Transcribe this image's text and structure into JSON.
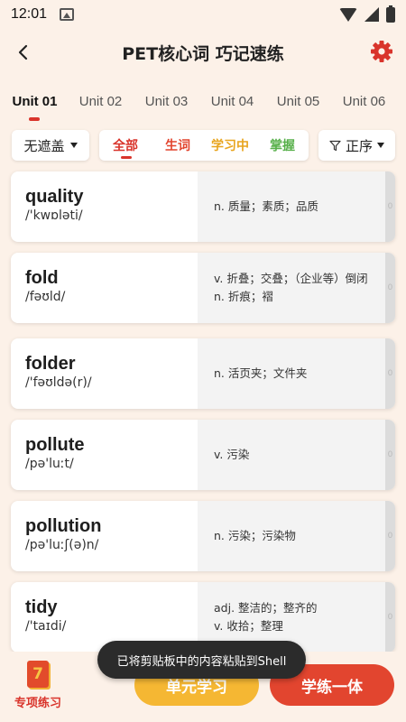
{
  "status_bar": {
    "time": "12:01"
  },
  "header": {
    "title": "PET核心词 巧记速练",
    "back_label": "‹"
  },
  "unit_tabs": [
    {
      "label": "Unit 01",
      "active": true
    },
    {
      "label": "Unit 02",
      "active": false
    },
    {
      "label": "Unit 03",
      "active": false
    },
    {
      "label": "Unit 04",
      "active": false
    },
    {
      "label": "Unit 05",
      "active": false
    },
    {
      "label": "Unit 06",
      "active": false
    }
  ],
  "filters": {
    "cover": "无遮盖",
    "status_items": [
      {
        "label": "全部",
        "color": "#d9342b",
        "active": true
      },
      {
        "label": "生词",
        "color": "#e2452f",
        "active": false
      },
      {
        "label": "学习中",
        "color": "#e8a51f",
        "active": false
      },
      {
        "label": "掌握",
        "color": "#57b04a",
        "active": false
      }
    ],
    "sort": "正序"
  },
  "words": [
    {
      "word": "quality",
      "phonetic": "/'kwɒləti/",
      "defs": [
        "n. 质量；素质；品质"
      ],
      "count": "0"
    },
    {
      "word": "fold",
      "phonetic": "/fəʊld/",
      "defs": [
        "v. 折叠；交叠；（企业等）倒闭",
        "n. 折痕；褶"
      ],
      "count": "0"
    },
    {
      "word": "folder",
      "phonetic": "/'fəʊldə(r)/",
      "defs": [
        "n. 活页夹；文件夹"
      ],
      "count": "0"
    },
    {
      "word": "pollute",
      "phonetic": "/pə'luːt/",
      "defs": [
        "v. 污染"
      ],
      "count": "0"
    },
    {
      "word": "pollution",
      "phonetic": "/pə'luːʃ(ə)n/",
      "defs": [
        "n. 污染；污染物"
      ],
      "count": "0"
    },
    {
      "word": "tidy",
      "phonetic": "/'taɪdi/",
      "defs": [
        "adj. 整洁的；整齐的",
        "v. 收拾；整理"
      ],
      "count": "0"
    }
  ],
  "bottom": {
    "special_label": "专项练习",
    "special_icon_text": "7",
    "unit_study": "单元学习",
    "practice": "学练一体"
  },
  "toast": "已将剪贴板中的内容粘贴到Shell",
  "colors": {
    "accent": "#d9342b",
    "background": "#fcf1e8",
    "unit_button": "#f5b733",
    "practice_button": "#e2452f"
  }
}
